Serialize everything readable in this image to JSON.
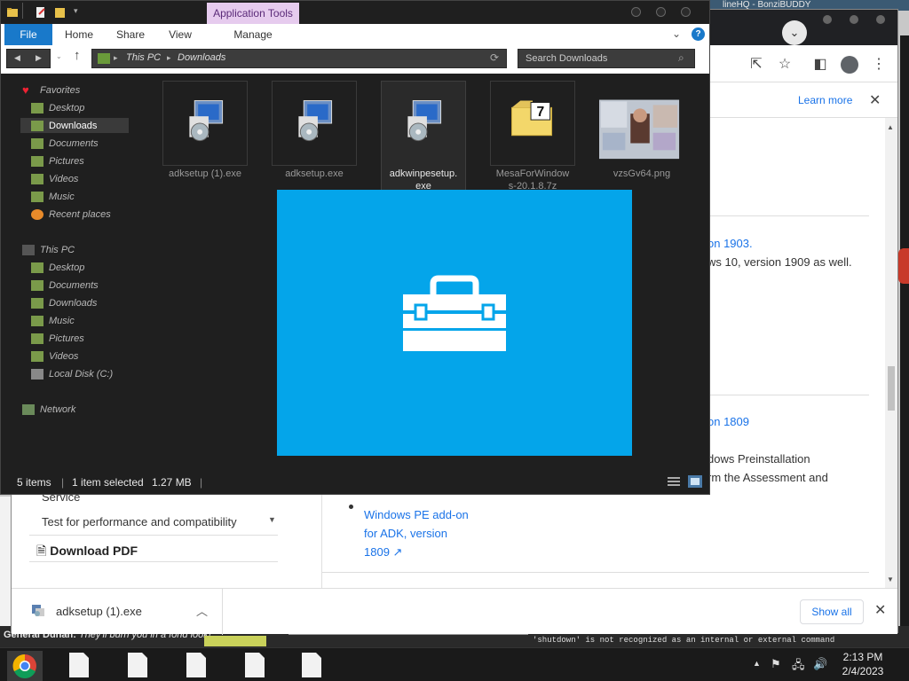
{
  "background": {
    "top_strip_text": "lineHQ - BonziBUDDY",
    "bottom_strip_left": "General Duhan:",
    "bottom_strip_msg": "They'll burn you in a fond look!",
    "bottom_strip_cmd": "'shutdown' is not recognized as an internal or external command"
  },
  "chrome": {
    "infobar": {
      "learn_more": "Learn more"
    },
    "sidebar": {
      "service": "Service",
      "item": "Test for performance and compatibility",
      "download_pdf": "Download PDF"
    },
    "article": {
      "line1": "on 1903.",
      "line2": "ws 10, version 1909 as well.",
      "line3": "on 1809",
      "line4": "dows Preinstallation",
      "line5": "rm the Assessment and",
      "bullet_l1": "Windows PE add-on",
      "bullet_l2": "for ADK, version",
      "bullet_l3": "1809 ↗"
    },
    "downloads_bar": {
      "file": "adksetup (1).exe",
      "show_all": "Show all"
    }
  },
  "explorer": {
    "context_tab": "Application Tools",
    "ribbon_tabs": [
      "File",
      "Home",
      "Share",
      "View",
      "Manage"
    ],
    "address": [
      "This PC",
      "Downloads"
    ],
    "search_placeholder": "Search Downloads",
    "nav": {
      "favorites": "Favorites",
      "fav_items": [
        "Desktop",
        "Downloads",
        "Documents",
        "Pictures",
        "Videos",
        "Music",
        "Recent places"
      ],
      "this_pc": "This PC",
      "pc_items": [
        "Desktop",
        "Documents",
        "Downloads",
        "Music",
        "Pictures",
        "Videos",
        "Local Disk (C:)"
      ],
      "network": "Network"
    },
    "files": [
      {
        "name": "adksetup (1).exe",
        "icon": "installer-icon"
      },
      {
        "name": "adksetup.exe",
        "icon": "installer-icon"
      },
      {
        "name": "adkwinpesetup.exe",
        "name_l1": "adkwinpesetup.",
        "name_l2": "exe",
        "icon": "installer-icon"
      },
      {
        "name": "MesaForWindows-20.1.8.7z",
        "name_l1": "MesaForWindow",
        "name_l2": "s-20.1.8.7z",
        "icon": "7z-archive-icon"
      },
      {
        "name": "vzsGv64.png",
        "icon": "image-thumbnail"
      }
    ],
    "status": {
      "count": "5 items",
      "selected": "1 item selected",
      "size": "1.27 MB"
    }
  },
  "splash": {
    "icon": "toolbox-icon",
    "color": "#04a5ea"
  },
  "taskbar": {
    "time": "2:13 PM",
    "date": "2/4/2023"
  }
}
